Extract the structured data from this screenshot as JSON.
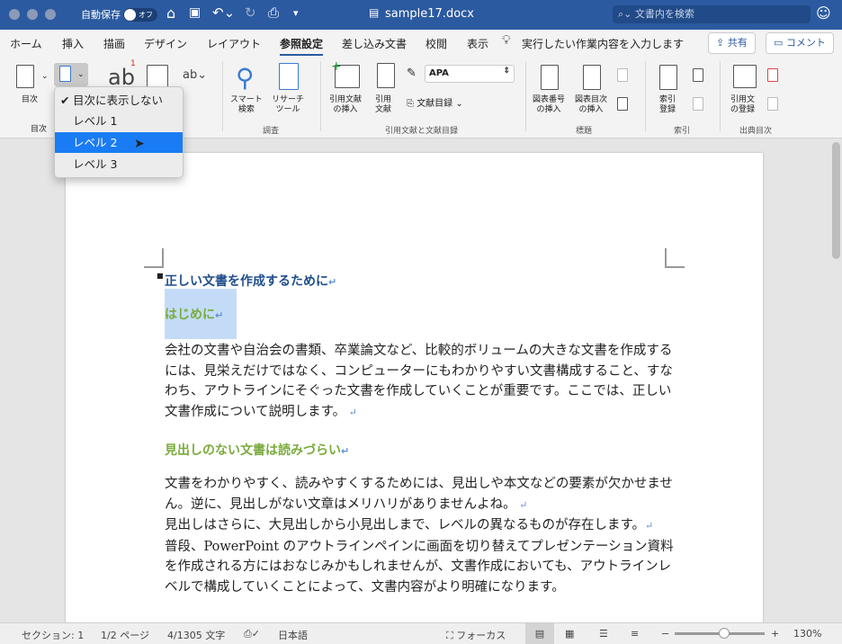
{
  "titlebar": {
    "autosave_label": "自動保存",
    "autosave_state": "オフ",
    "filename": "sample17.docx",
    "search_placeholder": "文書内を検索"
  },
  "tabs": [
    "ホーム",
    "挿入",
    "描画",
    "デザイン",
    "レイアウト",
    "参照設定",
    "差し込み文書",
    "校閲",
    "表示"
  ],
  "active_tab": "参照設定",
  "tell_me": "実行したい作業内容を入力します",
  "share_label": "共有",
  "comment_label": "コメント",
  "ribbon": {
    "toc_label": "目次",
    "toc_group": "目次",
    "smart_lookup": "スマート\n検索",
    "researcher": "リサーチ\nツール",
    "research_group": "調査",
    "insert_citation": "引用文献\nの挿入",
    "citation": "引用\n文献",
    "style_value": "APA",
    "bibliography": "文献目録",
    "citations_group": "引用文献と文献目録",
    "insert_caption": "図表番号\nの挿入",
    "insert_table_of_figures": "図表目次\nの挿入",
    "captions_group": "標題",
    "mark_entry": "索引\n登録",
    "index_group": "索引",
    "mark_citation": "引用文\nの登録",
    "authorities_group": "出典目次"
  },
  "dropdown": {
    "items": [
      "目次に表示しない",
      "レベル 1",
      "レベル 2",
      "レベル 3"
    ],
    "checked": 0,
    "highlighted": 2
  },
  "document": {
    "heading1": "正しい文書を作成するために",
    "heading2a": "はじめに",
    "para1": "会社の文書や自治会の書類、卒業論文など、比較的ボリュームの大きな文書を作成するには、見栄えだけではなく、コンピューターにもわかりやすい文書構成すること、すなわち、アウトラインにそぐった文書を作成していくことが重要です。ここでは、正しい文書作成について説明します。",
    "heading2b": "見出しのない文書は読みづらい",
    "para2": "文書をわかりやすく、読みやすくするためには、見出しや本文などの要素が欠かせません。逆に、見出しがない文章はメリハリがありませんよね。",
    "para3": "見出しはさらに、大見出しから小見出しまで、レベルの異なるものが存在します。",
    "para4": "普段、PowerPoint のアウトラインペインに画面を切り替えてプレゼンテーション資料を作成される方にはおなじみかもしれませんが、文書作成においても、アウトラインレベルで構成していくことによって、文書内容がより明確になります。"
  },
  "status": {
    "section": "セクション: 1",
    "page": "1/2 ページ",
    "words": "4/1305 文字",
    "language": "日本語",
    "focus": "フォーカス",
    "zoom": "130%",
    "zoom_fraction": 0.55
  }
}
